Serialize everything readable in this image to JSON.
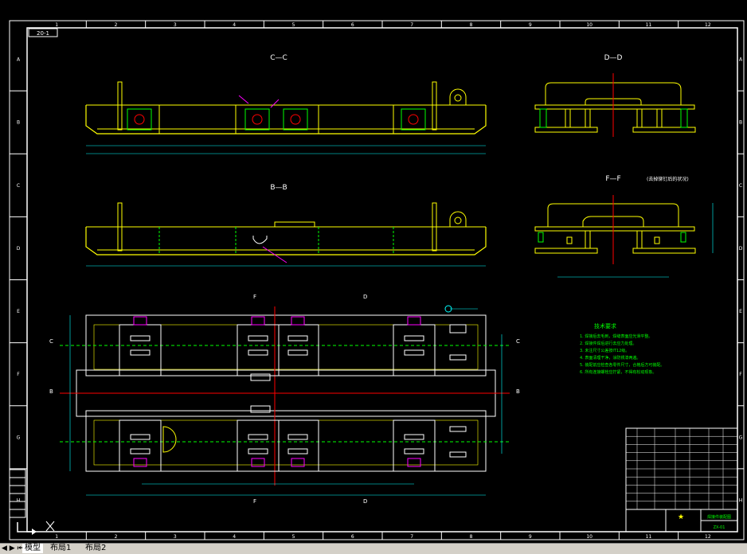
{
  "drawing": {
    "sheet_code": "20-1",
    "col_numbers": [
      "1",
      "2",
      "3",
      "4",
      "5",
      "6",
      "7",
      "8",
      "9",
      "10",
      "11",
      "12"
    ],
    "row_letters": [
      "A",
      "B",
      "C",
      "D",
      "E",
      "F",
      "G",
      "H"
    ],
    "views": {
      "cc": "C—C",
      "dd": "D—D",
      "bb": "B—B",
      "ff": "F—F",
      "ff_note": "(去掉铆钉后的状况)"
    },
    "section_marks": {
      "c_left": "C",
      "c_right": "C",
      "b_left": "B",
      "b_right": "B",
      "f_top": "F",
      "f_bottom": "F",
      "d_top": "D",
      "d_bottom": "D"
    },
    "tech_title": "技术要求",
    "tech_lines": [
      "1. 焊接后去毛刺，焊缝表面应光滑平整。",
      "2. 焊接件焊后进行去应力处理。",
      "3. 未注尺寸公差按IT12级。",
      "4. 表面清理干净，涂防锈漆两遍。",
      "5. 装配前应检查各零件尺寸，合格后方可装配。",
      "6. 所有连接螺栓应拧紧，不得有松动现象。"
    ],
    "title_block": {
      "part_name": "车架",
      "title_text": "焊接件装配图",
      "drawing_no": "ZX-01",
      "scale": "1:10",
      "symbol": "★"
    },
    "colors": {
      "frame": "#ffffff",
      "geometry": "#ffff00",
      "dims": "#00ffff",
      "hidden": "#00ff00",
      "center": "#ff0000",
      "leader": "#ff00ff",
      "notes": "#00ff00"
    }
  },
  "tabs": {
    "nav": "◀ ▶ ⏮ ⏭",
    "items": [
      "模型",
      "布局1",
      "布局2"
    ],
    "active": "模型"
  }
}
